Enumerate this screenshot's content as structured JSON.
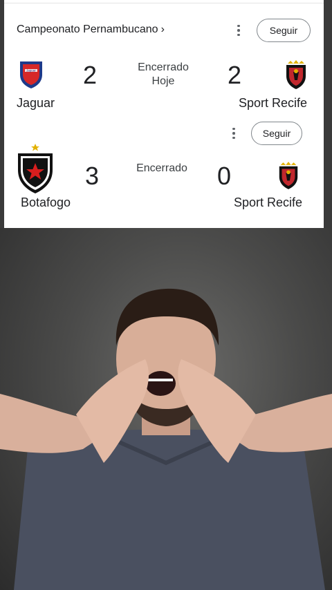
{
  "league": {
    "title": "Campeonato Pernambucano",
    "chevron": "›"
  },
  "follow_label": "Seguir",
  "matches": [
    {
      "status": "Encerrado",
      "date": "Hoje",
      "home": {
        "name": "Jaguar",
        "score": "2",
        "logo_text": "Jaguar"
      },
      "away": {
        "name": "Sport Recife",
        "score": "2"
      }
    },
    {
      "status": "Encerrado",
      "home": {
        "name": "Botafogo",
        "score": "3"
      },
      "away": {
        "name": "Sport Recife",
        "score": "0"
      }
    }
  ],
  "colors": {
    "jaguar_blue": "#1e3a8a",
    "jaguar_red": "#d62828",
    "sport_black": "#111111",
    "sport_red": "#c1272d",
    "sport_gold": "#e2b100",
    "botafogo_red": "#d81e1e",
    "text": "#202124",
    "background": "#ffffff"
  },
  "icons": [
    "more-vert-icon",
    "chevron-right-icon"
  ]
}
